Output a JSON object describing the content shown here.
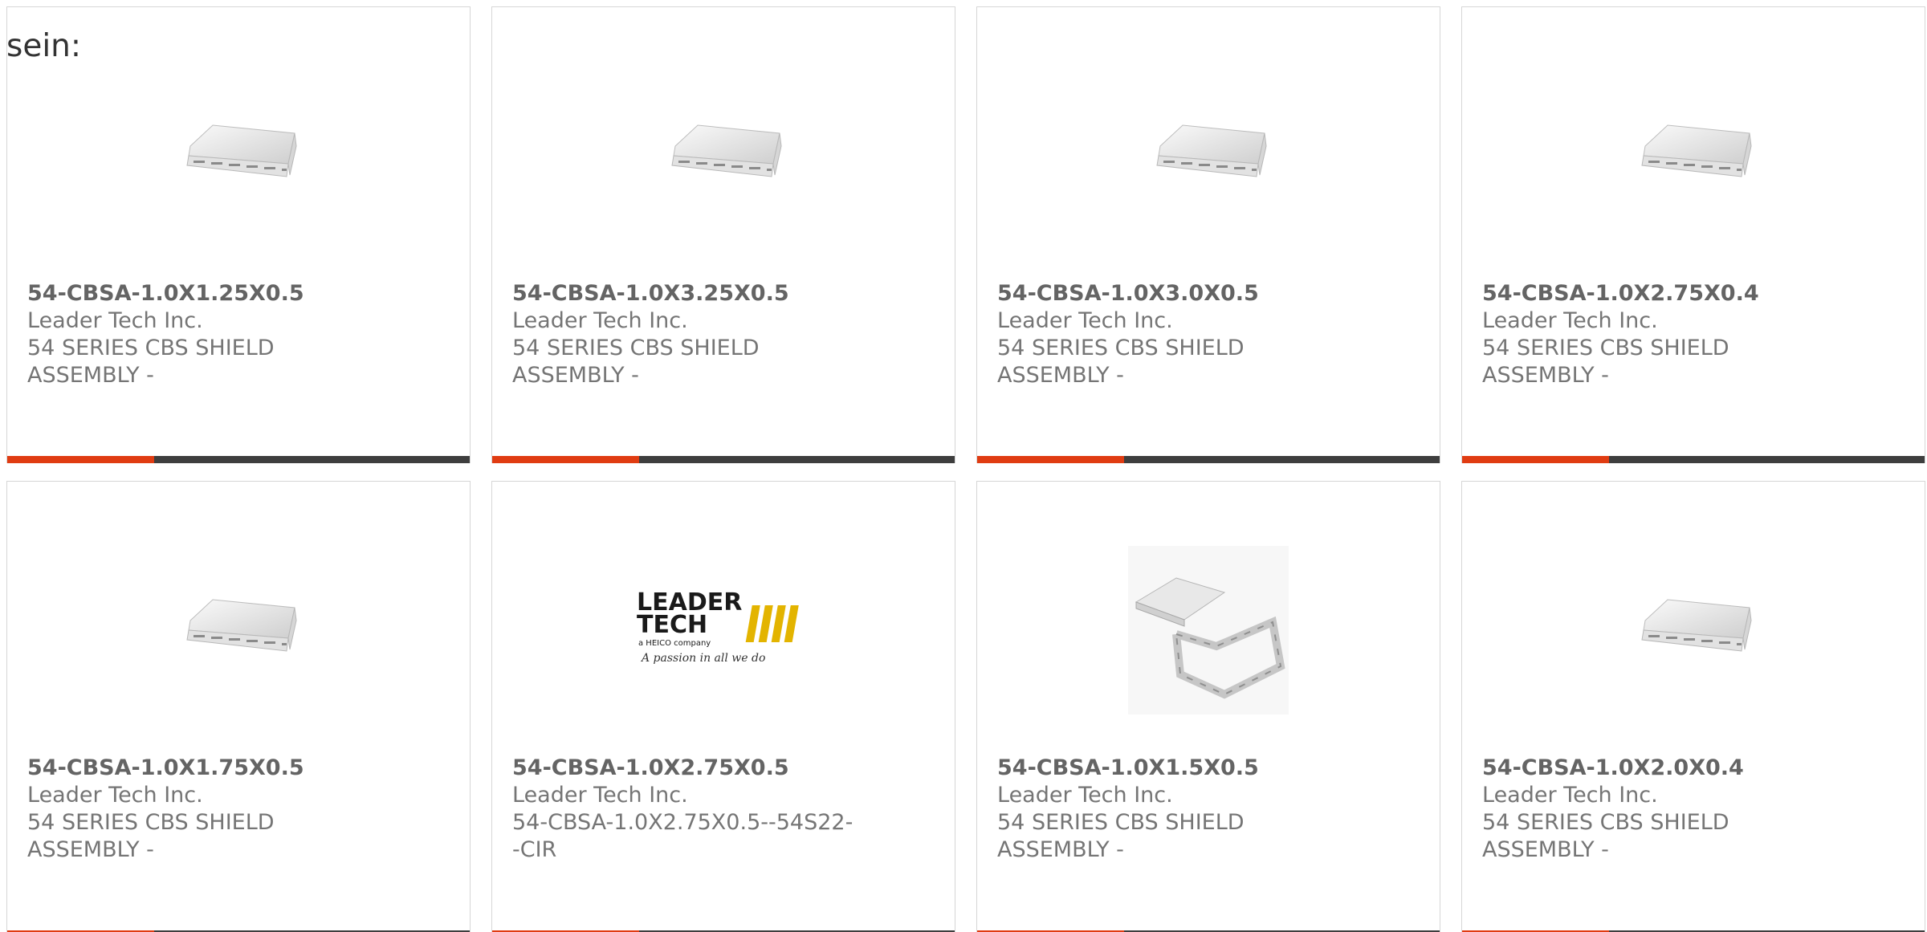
{
  "intro_text": "sein:",
  "accent_color": "#e03c12",
  "bar_color": "#3e3e3e",
  "products": [
    {
      "part_number": "54-CBSA-1.0X1.25X0.5",
      "manufacturer": "Leader Tech Inc.",
      "description": "54 SERIES CBS SHIELD ASSEMBLY -",
      "image": "shield-tray-image"
    },
    {
      "part_number": "54-CBSA-1.0X3.25X0.5",
      "manufacturer": "Leader Tech Inc.",
      "description": "54 SERIES CBS SHIELD ASSEMBLY -",
      "image": "shield-tray-image"
    },
    {
      "part_number": "54-CBSA-1.0X3.0X0.5",
      "manufacturer": "Leader Tech Inc.",
      "description": "54 SERIES CBS SHIELD ASSEMBLY -",
      "image": "shield-tray-image"
    },
    {
      "part_number": "54-CBSA-1.0X2.75X0.4",
      "manufacturer": "Leader Tech Inc.",
      "description": "54 SERIES CBS SHIELD ASSEMBLY -",
      "image": "shield-tray-image"
    },
    {
      "part_number": "54-CBSA-1.0X1.75X0.5",
      "manufacturer": "Leader Tech Inc.",
      "description": "54 SERIES CBS SHIELD ASSEMBLY -",
      "image": "shield-tray-image"
    },
    {
      "part_number": "54-CBSA-1.0X2.75X0.5",
      "manufacturer": "Leader Tech Inc.",
      "description": "54-CBSA-1.0X2.75X0.5--54S22--CIR",
      "image": "leader-tech-logo",
      "logo": {
        "line1": "LEADER",
        "line2": "TECH",
        "tagline": "a HEICO company",
        "slogan": "A passion in all we do"
      }
    },
    {
      "part_number": "54-CBSA-1.0X1.5X0.5",
      "manufacturer": "Leader Tech Inc.",
      "description": "54 SERIES CBS SHIELD ASSEMBLY -",
      "image": "shield-frame-image"
    },
    {
      "part_number": "54-CBSA-1.0X2.0X0.4",
      "manufacturer": "Leader Tech Inc.",
      "description": "54 SERIES CBS SHIELD ASSEMBLY -",
      "image": "shield-tray-image"
    }
  ]
}
